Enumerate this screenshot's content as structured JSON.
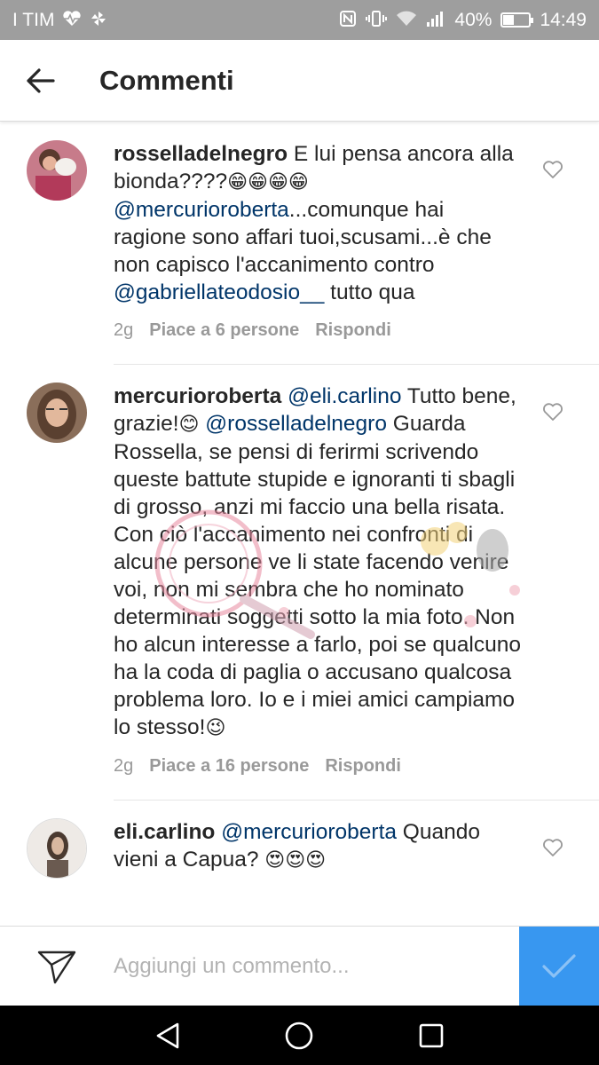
{
  "status": {
    "carrier": "I TIM",
    "battery_percent": "40%",
    "battery_level": 0.4,
    "time": "14:49",
    "icons": [
      "heart-signal-icon",
      "pinwheel-icon",
      "nfc-icon",
      "vibrate-icon",
      "wifi-icon",
      "cell-signal-icon",
      "battery-icon"
    ]
  },
  "header": {
    "title": "Commenti",
    "back_icon": "arrow-back-icon"
  },
  "comments": [
    {
      "username": "rosselladelnegro",
      "segments": [
        {
          "type": "text",
          "value": " E lui pensa ancora alla bionda????"
        },
        {
          "type": "emoji",
          "value": "😁😁😁😁"
        },
        {
          "type": "text",
          "value": " "
        },
        {
          "type": "mention",
          "value": "@mercurioroberta"
        },
        {
          "type": "text",
          "value": "...comunque hai ragione sono affari tuoi,scusami...è che non capisco l'accanimento contro "
        },
        {
          "type": "mention",
          "value": "@gabriellateodosio__"
        },
        {
          "type": "text",
          "value": " tutto qua"
        }
      ],
      "time": "2g",
      "likes": "Piace a 6 persone",
      "reply": "Rispondi"
    },
    {
      "username": "mercurioroberta",
      "segments": [
        {
          "type": "text",
          "value": " "
        },
        {
          "type": "mention",
          "value": "@eli.carlino"
        },
        {
          "type": "text",
          "value": " Tutto bene, grazie!"
        },
        {
          "type": "emoji",
          "value": "😊"
        },
        {
          "type": "text",
          "value": " "
        },
        {
          "type": "mention",
          "value": "@rosselladelnegro"
        },
        {
          "type": "text",
          "value": " Guarda Rossella, se pensi di ferirmi scrivendo queste battute stupide e ignoranti ti sbagli di grosso, anzi mi faccio una bella risata. Con ciò l'accanimento nei confronti di alcune persone ve li state facendo venire voi, non mi sembra che ho nominato determinati soggetti sotto la mia foto. Non ho alcun interesse a farlo, poi se qualcuno ha la coda di paglia o accusano qualcosa problema loro. Io e i miei amici campiamo lo stesso!"
        },
        {
          "type": "emoji",
          "value": "😉"
        }
      ],
      "time": "2g",
      "likes": "Piace a 16 persone",
      "reply": "Rispondi"
    },
    {
      "username": "eli.carlino",
      "segments": [
        {
          "type": "text",
          "value": " "
        },
        {
          "type": "mention",
          "value": "@mercurioroberta"
        },
        {
          "type": "text",
          "value": " Quando vieni a Capua? "
        },
        {
          "type": "emoji",
          "value": "😍😍😍"
        }
      ]
    }
  ],
  "compose": {
    "placeholder": "Aggiungi un commento...",
    "share_icon": "paper-plane-icon",
    "send_icon": "checkmark-icon"
  },
  "colors": {
    "status_bar": "#9e9e9e",
    "mention": "#003569",
    "meta": "#999999",
    "send_button": "#3897f0"
  }
}
